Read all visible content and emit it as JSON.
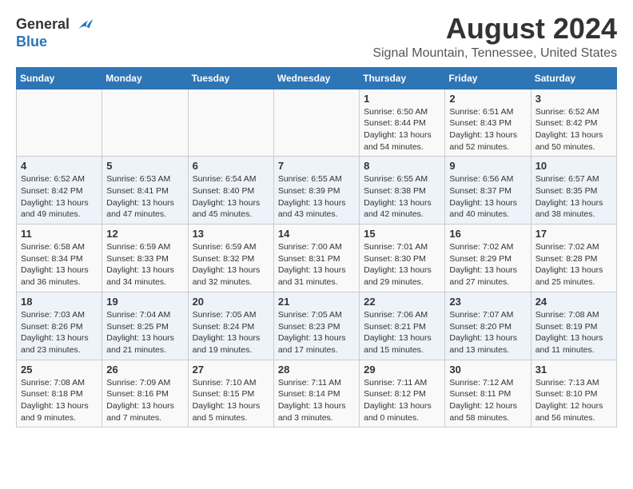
{
  "header": {
    "logo_general": "General",
    "logo_blue": "Blue",
    "month_title": "August 2024",
    "location": "Signal Mountain, Tennessee, United States"
  },
  "days_of_week": [
    "Sunday",
    "Monday",
    "Tuesday",
    "Wednesday",
    "Thursday",
    "Friday",
    "Saturday"
  ],
  "weeks": [
    [
      {
        "day": "",
        "info": ""
      },
      {
        "day": "",
        "info": ""
      },
      {
        "day": "",
        "info": ""
      },
      {
        "day": "",
        "info": ""
      },
      {
        "day": "1",
        "info": "Sunrise: 6:50 AM\nSunset: 8:44 PM\nDaylight: 13 hours\nand 54 minutes."
      },
      {
        "day": "2",
        "info": "Sunrise: 6:51 AM\nSunset: 8:43 PM\nDaylight: 13 hours\nand 52 minutes."
      },
      {
        "day": "3",
        "info": "Sunrise: 6:52 AM\nSunset: 8:42 PM\nDaylight: 13 hours\nand 50 minutes."
      }
    ],
    [
      {
        "day": "4",
        "info": "Sunrise: 6:52 AM\nSunset: 8:42 PM\nDaylight: 13 hours\nand 49 minutes."
      },
      {
        "day": "5",
        "info": "Sunrise: 6:53 AM\nSunset: 8:41 PM\nDaylight: 13 hours\nand 47 minutes."
      },
      {
        "day": "6",
        "info": "Sunrise: 6:54 AM\nSunset: 8:40 PM\nDaylight: 13 hours\nand 45 minutes."
      },
      {
        "day": "7",
        "info": "Sunrise: 6:55 AM\nSunset: 8:39 PM\nDaylight: 13 hours\nand 43 minutes."
      },
      {
        "day": "8",
        "info": "Sunrise: 6:55 AM\nSunset: 8:38 PM\nDaylight: 13 hours\nand 42 minutes."
      },
      {
        "day": "9",
        "info": "Sunrise: 6:56 AM\nSunset: 8:37 PM\nDaylight: 13 hours\nand 40 minutes."
      },
      {
        "day": "10",
        "info": "Sunrise: 6:57 AM\nSunset: 8:35 PM\nDaylight: 13 hours\nand 38 minutes."
      }
    ],
    [
      {
        "day": "11",
        "info": "Sunrise: 6:58 AM\nSunset: 8:34 PM\nDaylight: 13 hours\nand 36 minutes."
      },
      {
        "day": "12",
        "info": "Sunrise: 6:59 AM\nSunset: 8:33 PM\nDaylight: 13 hours\nand 34 minutes."
      },
      {
        "day": "13",
        "info": "Sunrise: 6:59 AM\nSunset: 8:32 PM\nDaylight: 13 hours\nand 32 minutes."
      },
      {
        "day": "14",
        "info": "Sunrise: 7:00 AM\nSunset: 8:31 PM\nDaylight: 13 hours\nand 31 minutes."
      },
      {
        "day": "15",
        "info": "Sunrise: 7:01 AM\nSunset: 8:30 PM\nDaylight: 13 hours\nand 29 minutes."
      },
      {
        "day": "16",
        "info": "Sunrise: 7:02 AM\nSunset: 8:29 PM\nDaylight: 13 hours\nand 27 minutes."
      },
      {
        "day": "17",
        "info": "Sunrise: 7:02 AM\nSunset: 8:28 PM\nDaylight: 13 hours\nand 25 minutes."
      }
    ],
    [
      {
        "day": "18",
        "info": "Sunrise: 7:03 AM\nSunset: 8:26 PM\nDaylight: 13 hours\nand 23 minutes."
      },
      {
        "day": "19",
        "info": "Sunrise: 7:04 AM\nSunset: 8:25 PM\nDaylight: 13 hours\nand 21 minutes."
      },
      {
        "day": "20",
        "info": "Sunrise: 7:05 AM\nSunset: 8:24 PM\nDaylight: 13 hours\nand 19 minutes."
      },
      {
        "day": "21",
        "info": "Sunrise: 7:05 AM\nSunset: 8:23 PM\nDaylight: 13 hours\nand 17 minutes."
      },
      {
        "day": "22",
        "info": "Sunrise: 7:06 AM\nSunset: 8:21 PM\nDaylight: 13 hours\nand 15 minutes."
      },
      {
        "day": "23",
        "info": "Sunrise: 7:07 AM\nSunset: 8:20 PM\nDaylight: 13 hours\nand 13 minutes."
      },
      {
        "day": "24",
        "info": "Sunrise: 7:08 AM\nSunset: 8:19 PM\nDaylight: 13 hours\nand 11 minutes."
      }
    ],
    [
      {
        "day": "25",
        "info": "Sunrise: 7:08 AM\nSunset: 8:18 PM\nDaylight: 13 hours\nand 9 minutes."
      },
      {
        "day": "26",
        "info": "Sunrise: 7:09 AM\nSunset: 8:16 PM\nDaylight: 13 hours\nand 7 minutes."
      },
      {
        "day": "27",
        "info": "Sunrise: 7:10 AM\nSunset: 8:15 PM\nDaylight: 13 hours\nand 5 minutes."
      },
      {
        "day": "28",
        "info": "Sunrise: 7:11 AM\nSunset: 8:14 PM\nDaylight: 13 hours\nand 3 minutes."
      },
      {
        "day": "29",
        "info": "Sunrise: 7:11 AM\nSunset: 8:12 PM\nDaylight: 13 hours\nand 0 minutes."
      },
      {
        "day": "30",
        "info": "Sunrise: 7:12 AM\nSunset: 8:11 PM\nDaylight: 12 hours\nand 58 minutes."
      },
      {
        "day": "31",
        "info": "Sunrise: 7:13 AM\nSunset: 8:10 PM\nDaylight: 12 hours\nand 56 minutes."
      }
    ]
  ]
}
